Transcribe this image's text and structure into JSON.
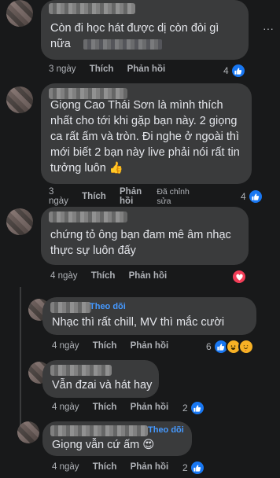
{
  "comments": [
    {
      "text_line1": "Còn đi học hát được dị còn đòi gì",
      "text_line2": "nữa",
      "time": "3 ngày",
      "like": "Thích",
      "reply": "Phản hồi",
      "reaction_count": "4",
      "reactions": [
        "like-icon"
      ]
    },
    {
      "text": "Giọng Cao Thái Sơn là mình thích nhất cho tới khi gặp bạn này. 2 giọng ca rất ấm và tròn. Đi nghe ở ngoài thì mới biết 2 bạn này live phải nói rất tin tưởng luôn 👍",
      "time_line1": "3",
      "time_line2": "ngày",
      "like": "Thích",
      "reply_line1": "Phản",
      "reply_line2": "hồi",
      "edited_line1": "Đã chỉnh",
      "edited_line2": "sửa",
      "reaction_count": "4",
      "reactions": [
        "like-icon"
      ]
    },
    {
      "text_line1": "chứng tỏ ông bạn đam mê âm nhạc",
      "text_line2": "thực sự luôn đấy",
      "time": "4 ngày",
      "like": "Thích",
      "reply": "Phản hồi",
      "reactions": [
        "love-icon"
      ]
    },
    {
      "follow": "Theo dõi",
      "text": "Nhạc thì rất chill, MV thì mắc cười",
      "time": "4 ngày",
      "like": "Thích",
      "reply": "Phản hồi",
      "reaction_count": "6",
      "reactions": [
        "like-icon",
        "haha-icon",
        "wow-icon"
      ]
    },
    {
      "text": "Vẫn đzai và hát hay",
      "time": "4 ngày",
      "like": "Thích",
      "reply": "Phản hồi",
      "reaction_count": "2",
      "reactions": [
        "like-icon"
      ]
    },
    {
      "follow": "Theo dõi",
      "text": "Giọng vẫn cứ ấm 😍",
      "time": "4 ngày",
      "like": "Thích",
      "reply": "Phản hồi",
      "reaction_count": "2",
      "reactions": [
        "like-icon"
      ]
    }
  ],
  "colors": {
    "background": "#18191a",
    "bubble": "#3a3b3c",
    "follow": "#4599ff",
    "like": "#1877f2",
    "love": "#f33e58"
  }
}
